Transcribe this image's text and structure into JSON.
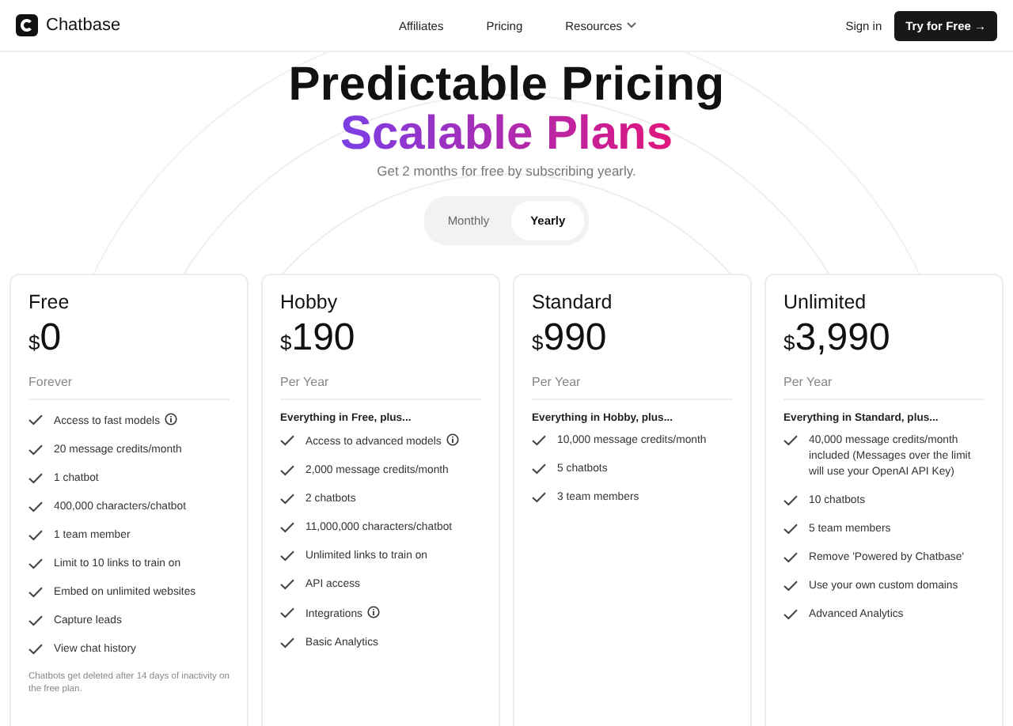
{
  "nav": {
    "brand": "Chatbase",
    "links": [
      {
        "label": "Affiliates",
        "dropdown": false
      },
      {
        "label": "Pricing",
        "dropdown": false
      },
      {
        "label": "Resources",
        "dropdown": true
      }
    ],
    "sign_in": "Sign in",
    "cta": "Try for Free →"
  },
  "hero": {
    "title": "Predictable Pricing",
    "subtitle": "Scalable Plans",
    "tagline": "Get 2 months for free by subscribing yearly."
  },
  "billing_toggle": [
    {
      "label": "Monthly",
      "selected": false
    },
    {
      "label": "Yearly",
      "selected": true
    }
  ],
  "plans": [
    {
      "name": "Free",
      "currency": "$",
      "price": "0",
      "period": "Forever",
      "features": [
        {
          "text": "Access to fast models",
          "info": true
        },
        {
          "text": "20 message credits/month",
          "info": false
        },
        {
          "text": "1 chatbot",
          "info": false
        },
        {
          "text": "400,000 characters/chatbot",
          "info": false
        },
        {
          "text": "1 team member",
          "info": false
        },
        {
          "text": "Limit to 10 links to train on",
          "info": false
        },
        {
          "text": "Embed on unlimited websites",
          "info": false
        },
        {
          "text": "Capture leads",
          "info": false
        },
        {
          "text": "View chat history",
          "info": false
        }
      ],
      "note": "Chatbots get deleted after 14 days of inactivity on the free plan."
    },
    {
      "name": "Hobby",
      "currency": "$",
      "price": "190",
      "period": "Per Year",
      "intro": "Everything in Free, plus...",
      "features": [
        {
          "text": "Access to advanced models",
          "info": true
        },
        {
          "text": "2,000 message credits/month",
          "info": false
        },
        {
          "text": "2 chatbots",
          "info": false
        },
        {
          "text": "11,000,000 characters/chatbot",
          "info": false
        },
        {
          "text": "Unlimited links to train on",
          "info": false
        },
        {
          "text": "API access",
          "info": false
        },
        {
          "text": "Integrations",
          "info": true
        },
        {
          "text": "Basic Analytics",
          "info": false
        }
      ]
    },
    {
      "name": "Standard",
      "currency": "$",
      "price": "990",
      "period": "Per Year",
      "intro": "Everything in Hobby, plus...",
      "features": [
        {
          "text": "10,000 message credits/month",
          "info": false
        },
        {
          "text": "5 chatbots",
          "info": false
        },
        {
          "text": "3 team members",
          "info": false
        }
      ]
    },
    {
      "name": "Unlimited",
      "currency": "$",
      "price": "3,990",
      "period": "Per Year",
      "intro": "Everything in Standard, plus...",
      "features": [
        {
          "text": "40,000 message credits/month included (Messages over the limit will use your OpenAI API Key)",
          "info": false
        },
        {
          "text": "10 chatbots",
          "info": false
        },
        {
          "text": "5 team members",
          "info": false
        },
        {
          "text": "Remove 'Powered by Chatbase'",
          "info": false
        },
        {
          "text": "Use your own custom domains",
          "info": false
        },
        {
          "text": "Advanced Analytics",
          "info": false
        }
      ]
    }
  ]
}
